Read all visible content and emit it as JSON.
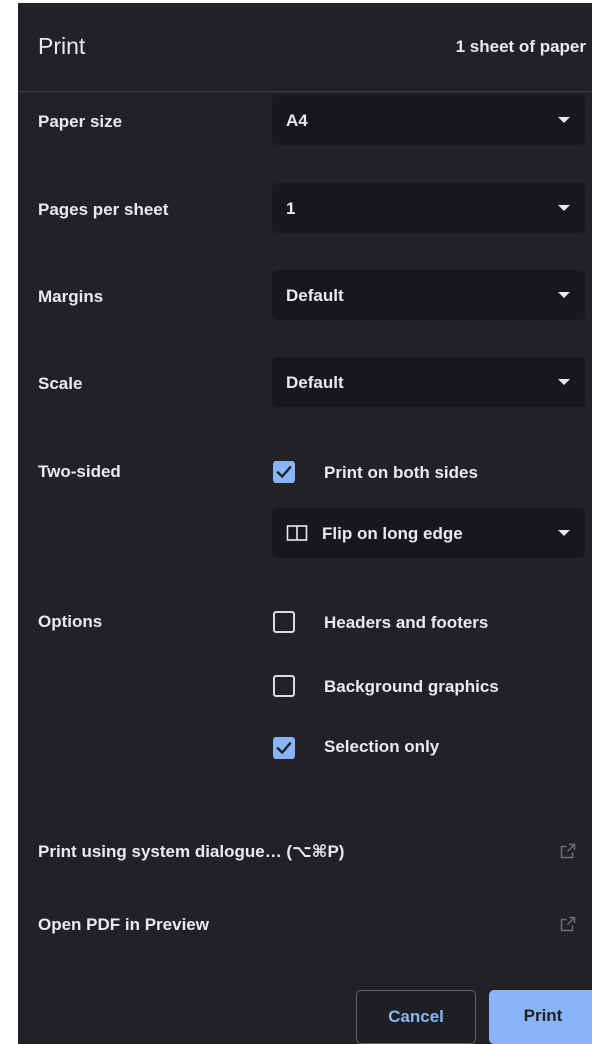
{
  "header": {
    "title": "Print",
    "sheet_count": "1 sheet of paper"
  },
  "paper_size": {
    "label": "Paper size",
    "value": "A4"
  },
  "pages_per_sheet": {
    "label": "Pages per sheet",
    "value": "1"
  },
  "margins": {
    "label": "Margins",
    "value": "Default"
  },
  "scale": {
    "label": "Scale",
    "value": "Default"
  },
  "two_sided": {
    "label": "Two-sided",
    "checkbox_label": "Print on both sides",
    "checked": true,
    "flip_value": "Flip on long edge"
  },
  "options": {
    "label": "Options",
    "items": [
      {
        "label": "Headers and footers",
        "checked": false
      },
      {
        "label": "Background graphics",
        "checked": false
      },
      {
        "label": "Selection only",
        "checked": true
      }
    ]
  },
  "links": {
    "system_dialog": "Print using system dialogue… (⌥⌘P)",
    "open_pdf": "Open PDF in Preview"
  },
  "buttons": {
    "cancel": "Cancel",
    "print": "Print"
  },
  "colors": {
    "panel_bg": "#212226",
    "accent": "#8ab4f8",
    "select_bg": "#17181b"
  }
}
